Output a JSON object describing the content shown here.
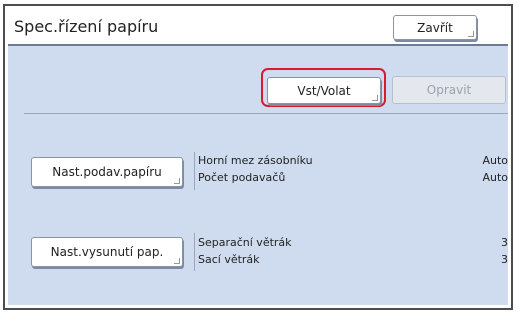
{
  "header": {
    "title": "Spec.řízení papíru",
    "close_label": "Zavřít"
  },
  "actions": {
    "vst_volat_label": "Vst/Volat",
    "opravit_label": "Opravit"
  },
  "feed": {
    "button_label": "Nast.podav.papíru",
    "rows": [
      {
        "label": "Horní mez zásobníku",
        "value": "Auto"
      },
      {
        "label": "Počet podavačů",
        "value": "Auto"
      }
    ]
  },
  "eject": {
    "button_label": "Nast.vysunutí pap.",
    "rows": [
      {
        "label": "Separační větrák",
        "value": "3"
      },
      {
        "label": "Sací větrák",
        "value": "3"
      }
    ]
  },
  "colors": {
    "panel_bg": "#cfdcef",
    "highlight": "#d81c2c",
    "frame": "#4d4d4d"
  }
}
